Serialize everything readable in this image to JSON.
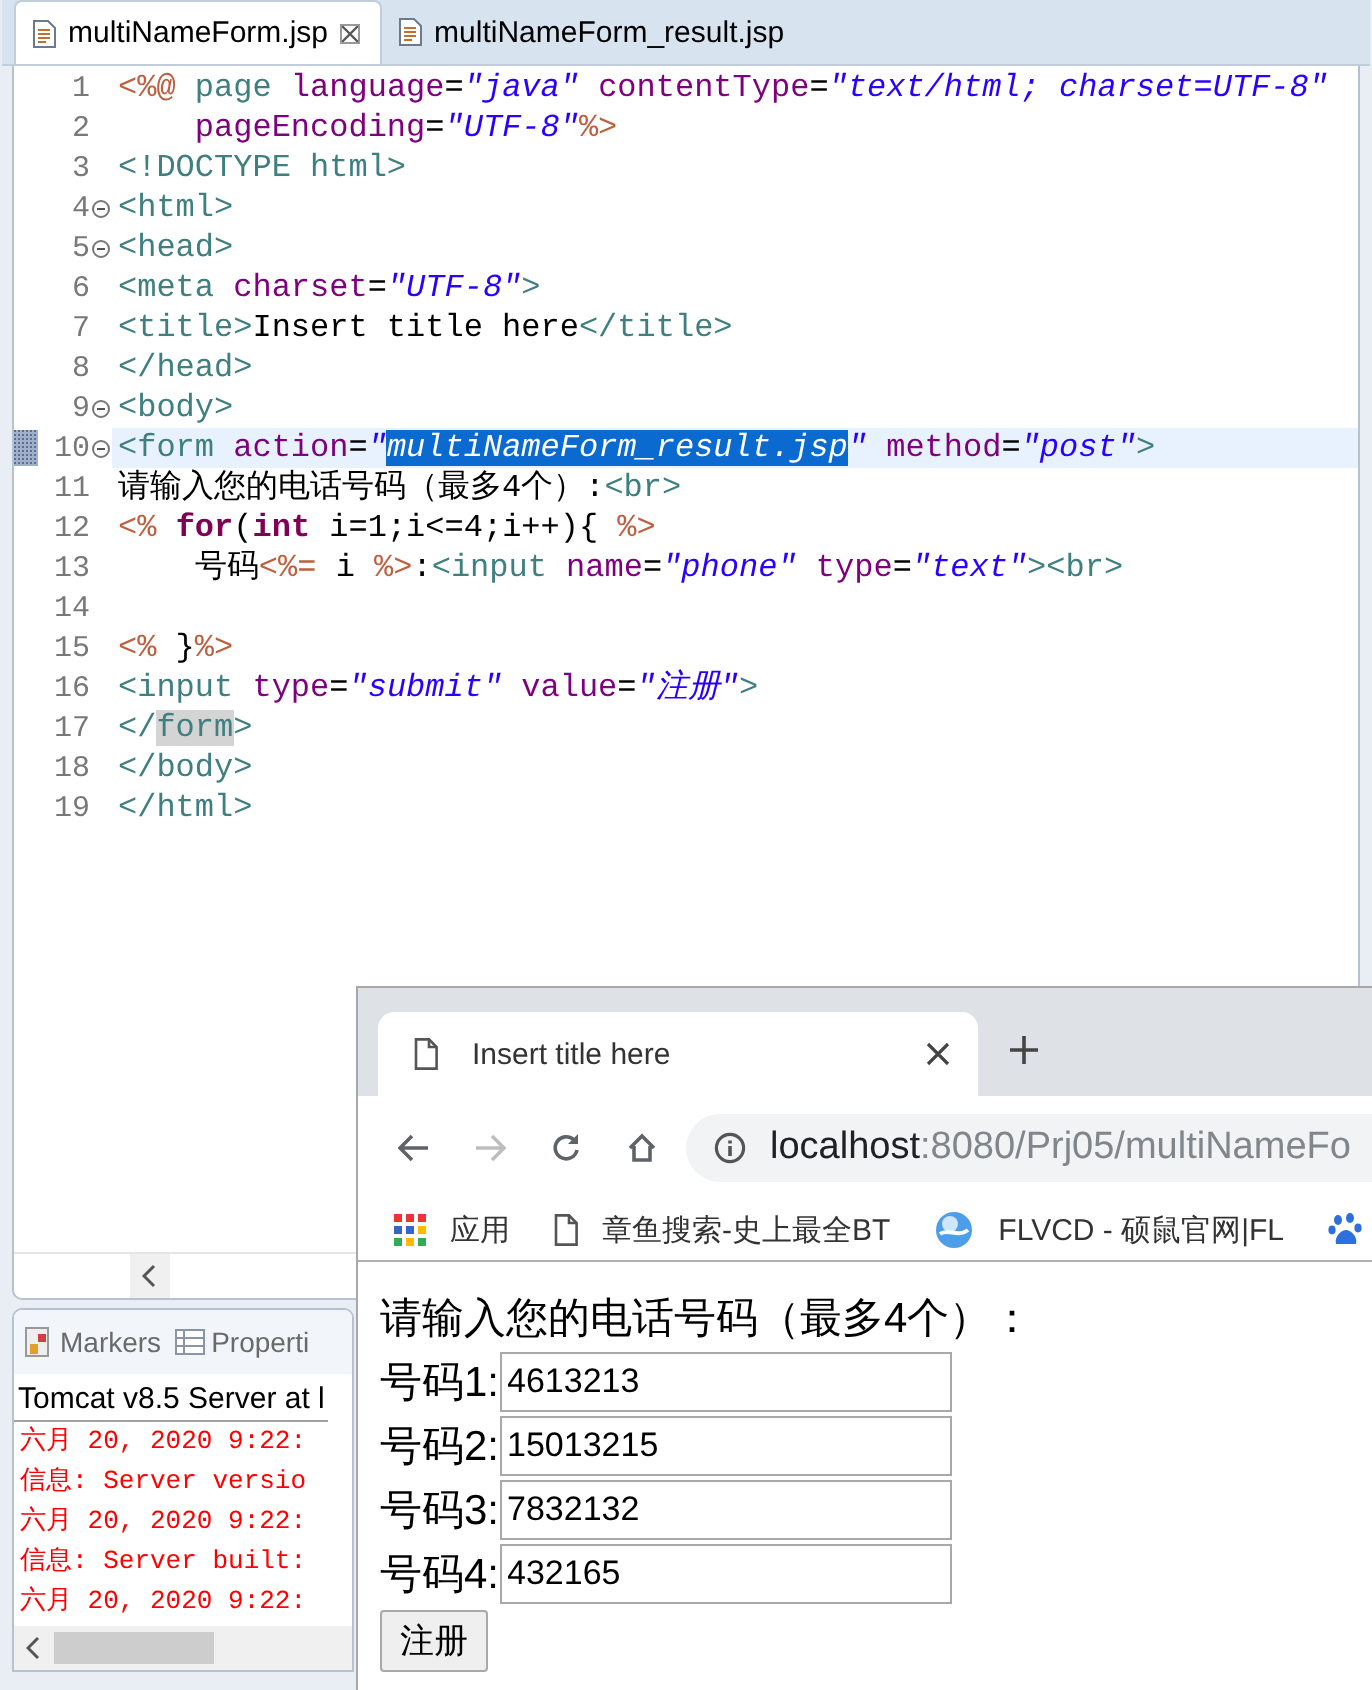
{
  "editor": {
    "tabs": [
      {
        "label": "multiNameForm.jsp",
        "selected": true
      },
      {
        "label": "multiNameForm_result.jsp",
        "selected": false
      }
    ],
    "lines": [
      {
        "number": "1",
        "fold": false,
        "current": false,
        "segments": [
          {
            "kind": "jsp",
            "text": "<%@"
          },
          {
            "kind": "tag",
            "text": " page"
          },
          {
            "kind": "attr",
            "text": " language"
          },
          {
            "kind": "text",
            "text": "="
          },
          {
            "kind": "str",
            "text": "\"java\""
          },
          {
            "kind": "attr",
            "text": " contentType"
          },
          {
            "kind": "text",
            "text": "="
          },
          {
            "kind": "str",
            "text": "\"text/html; charset=UTF-8\""
          }
        ]
      },
      {
        "number": "2",
        "fold": false,
        "current": false,
        "segments": [
          {
            "kind": "attr",
            "text": "    pageEncoding"
          },
          {
            "kind": "text",
            "text": "="
          },
          {
            "kind": "str",
            "text": "\"UTF-8\""
          },
          {
            "kind": "jsp",
            "text": "%>"
          }
        ]
      },
      {
        "number": "3",
        "fold": false,
        "current": false,
        "segments": [
          {
            "kind": "tag",
            "text": "<!DOCTYPE html>"
          }
        ]
      },
      {
        "number": "4",
        "fold": true,
        "current": false,
        "segments": [
          {
            "kind": "tag",
            "text": "<html>"
          }
        ]
      },
      {
        "number": "5",
        "fold": true,
        "current": false,
        "segments": [
          {
            "kind": "tag",
            "text": "<head>"
          }
        ]
      },
      {
        "number": "6",
        "fold": false,
        "current": false,
        "segments": [
          {
            "kind": "tag",
            "text": "<meta"
          },
          {
            "kind": "attr",
            "text": " charset"
          },
          {
            "kind": "text",
            "text": "="
          },
          {
            "kind": "str",
            "text": "\"UTF-8\""
          },
          {
            "kind": "tag",
            "text": ">"
          }
        ]
      },
      {
        "number": "7",
        "fold": false,
        "current": false,
        "segments": [
          {
            "kind": "tag",
            "text": "<title>"
          },
          {
            "kind": "text",
            "text": "Insert title here"
          },
          {
            "kind": "tag",
            "text": "</title>"
          }
        ]
      },
      {
        "number": "8",
        "fold": false,
        "current": false,
        "segments": [
          {
            "kind": "tag",
            "text": "</head>"
          }
        ]
      },
      {
        "number": "9",
        "fold": true,
        "current": false,
        "segments": [
          {
            "kind": "tag",
            "text": "<body>"
          }
        ]
      },
      {
        "number": "10",
        "fold": true,
        "current": true,
        "segments": [
          {
            "kind": "tag",
            "text": "<form"
          },
          {
            "kind": "attr",
            "text": " action"
          },
          {
            "kind": "text",
            "text": "="
          },
          {
            "kind": "str",
            "text": "\""
          },
          {
            "kind": "sel",
            "text": "multiNameForm_result.jsp"
          },
          {
            "kind": "str",
            "text": "\""
          },
          {
            "kind": "attr",
            "text": " method"
          },
          {
            "kind": "text",
            "text": "="
          },
          {
            "kind": "str",
            "text": "\"post\""
          },
          {
            "kind": "tag",
            "text": ">"
          }
        ]
      },
      {
        "number": "11",
        "fold": false,
        "current": false,
        "segments": [
          {
            "kind": "text",
            "text": "请输入您的电话号码（最多4个）:"
          },
          {
            "kind": "tag",
            "text": "<br>"
          }
        ]
      },
      {
        "number": "12",
        "fold": false,
        "current": false,
        "segments": [
          {
            "kind": "jsp",
            "text": "<% "
          },
          {
            "kind": "kw",
            "text": "for"
          },
          {
            "kind": "text",
            "text": "("
          },
          {
            "kind": "kw",
            "text": "int"
          },
          {
            "kind": "text",
            "text": " i=1;i<=4;i++){ "
          },
          {
            "kind": "jsp",
            "text": "%>"
          }
        ]
      },
      {
        "number": "13",
        "fold": false,
        "current": false,
        "segments": [
          {
            "kind": "text",
            "text": "    号码"
          },
          {
            "kind": "jsp",
            "text": "<%="
          },
          {
            "kind": "text",
            "text": " i "
          },
          {
            "kind": "jsp",
            "text": "%>"
          },
          {
            "kind": "text",
            "text": ":"
          },
          {
            "kind": "tag",
            "text": "<input"
          },
          {
            "kind": "attr",
            "text": " name"
          },
          {
            "kind": "text",
            "text": "="
          },
          {
            "kind": "str",
            "text": "\"phone\""
          },
          {
            "kind": "attr",
            "text": " type"
          },
          {
            "kind": "text",
            "text": "="
          },
          {
            "kind": "str",
            "text": "\"text\""
          },
          {
            "kind": "tag",
            "text": "><br>"
          }
        ]
      },
      {
        "number": "14",
        "fold": false,
        "current": false
      },
      {
        "number": "15",
        "fold": false,
        "current": false,
        "segments": [
          {
            "kind": "jsp",
            "text": "<%"
          },
          {
            "kind": "text",
            "text": " }"
          },
          {
            "kind": "jsp",
            "text": "%>"
          }
        ]
      },
      {
        "number": "16",
        "fold": false,
        "current": false,
        "segments": [
          {
            "kind": "tag",
            "text": "<input"
          },
          {
            "kind": "attr",
            "text": " type"
          },
          {
            "kind": "text",
            "text": "="
          },
          {
            "kind": "str",
            "text": "\"submit\""
          },
          {
            "kind": "attr",
            "text": " value"
          },
          {
            "kind": "text",
            "text": "="
          },
          {
            "kind": "str",
            "text": "\"注册\""
          },
          {
            "kind": "tag",
            "text": ">"
          }
        ]
      },
      {
        "number": "17",
        "fold": false,
        "current": false,
        "segments": [
          {
            "kind": "tag",
            "text": "</"
          },
          {
            "kind": "occ",
            "text": "form"
          },
          {
            "kind": "tag",
            "text": ">"
          }
        ]
      },
      {
        "number": "18",
        "fold": false,
        "current": false,
        "segments": [
          {
            "kind": "tag",
            "text": "</body>"
          }
        ]
      },
      {
        "number": "19",
        "fold": false,
        "current": false,
        "segments": [
          {
            "kind": "tag",
            "text": "</html>"
          }
        ]
      }
    ]
  },
  "bottom_panel": {
    "tabs": [
      {
        "label": "Markers",
        "kind": "markers"
      },
      {
        "label": "Properti",
        "kind": "properties"
      }
    ],
    "console_title": "Tomcat v8.5 Server at l",
    "console_lines": [
      "六月 20, 2020 9:22:",
      "信息: Server versio",
      "六月 20, 2020 9:22:",
      "信息: Server built:",
      "六月 20, 2020 9:22:"
    ]
  },
  "browser": {
    "tabs": [
      {
        "label": "Insert title here",
        "selected": true
      }
    ],
    "nav": [
      {
        "kind": "back",
        "disabled": false
      },
      {
        "kind": "forward",
        "disabled": true
      },
      {
        "kind": "reload",
        "disabled": false
      },
      {
        "kind": "home",
        "disabled": false
      }
    ],
    "url_host": "localhost",
    "url_rest": ":8080/Prj05/multiNameFo",
    "bookmarks": [
      {
        "kind": "apps",
        "label": "应用"
      },
      {
        "kind": "page",
        "label": "章鱼搜索-史上最全BT"
      },
      {
        "kind": "globe",
        "label": "FLVCD - 硕鼠官网|FL"
      },
      {
        "kind": "paw"
      }
    ],
    "page": {
      "heading": "请输入您的电话号码（最多4个）：",
      "fields": [
        {
          "label": "号码1:",
          "value": "4613213"
        },
        {
          "label": "号码2:",
          "value": "15013215"
        },
        {
          "label": "号码3:",
          "value": "7832132"
        },
        {
          "label": "号码4:",
          "value": "432165"
        }
      ],
      "submit": "注册"
    }
  }
}
